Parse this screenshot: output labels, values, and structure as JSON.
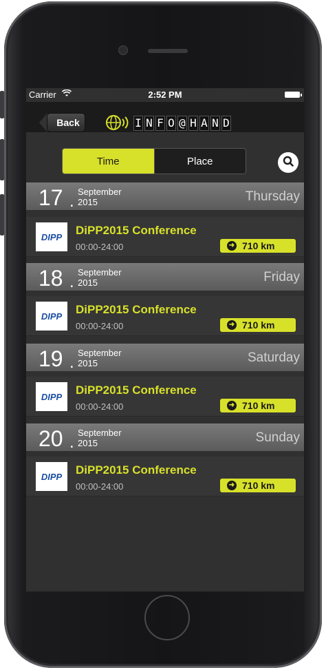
{
  "status_bar": {
    "carrier": "Carrier",
    "time": "2:52 PM"
  },
  "nav": {
    "back_label": "Back",
    "logo_letters": [
      "I",
      "N",
      "F",
      "O",
      "@",
      "H",
      "A",
      "N",
      "D"
    ]
  },
  "segmented": {
    "time": "Time",
    "place": "Place",
    "selected": "Time"
  },
  "accent_color": "#d8e12a",
  "days": [
    {
      "day": "17",
      "month": "September",
      "year": "2015",
      "weekday": "Thursday",
      "event": {
        "logo": "DIPP",
        "title": "DiPP2015 Conference",
        "time": "00:00-24:00",
        "distance": "710 km"
      }
    },
    {
      "day": "18",
      "month": "September",
      "year": "2015",
      "weekday": "Friday",
      "event": {
        "logo": "DIPP",
        "title": "DiPP2015 Conference",
        "time": "00:00-24:00",
        "distance": "710 km"
      }
    },
    {
      "day": "19",
      "month": "September",
      "year": "2015",
      "weekday": "Saturday",
      "event": {
        "logo": "DIPP",
        "title": "DiPP2015 Conference",
        "time": "00:00-24:00",
        "distance": "710 km"
      }
    },
    {
      "day": "20",
      "month": "September",
      "year": "2015",
      "weekday": "Sunday",
      "event": {
        "logo": "DIPP",
        "title": "DiPP2015 Conference",
        "time": "00:00-24:00",
        "distance": "710 km"
      }
    }
  ]
}
